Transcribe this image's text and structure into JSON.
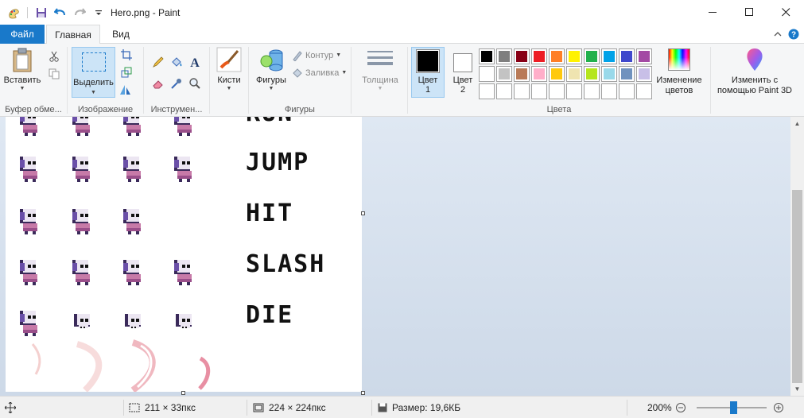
{
  "window": {
    "title": "Hero.png - Paint",
    "controls": {
      "minimize": "—",
      "maximize": "☐",
      "close": "✕"
    }
  },
  "quick_access": [
    {
      "icon": "paint-app-icon"
    },
    {
      "icon": "save-icon"
    },
    {
      "icon": "undo-icon"
    },
    {
      "icon": "redo-icon"
    },
    {
      "icon": "customize-qat-icon"
    }
  ],
  "tabs": {
    "file": "Файл",
    "home": "Главная",
    "view": "Вид"
  },
  "ribbon": {
    "clipboard": {
      "paste": "Вставить",
      "label": "Буфер обме..."
    },
    "image": {
      "select": "Выделить",
      "label": "Изображение"
    },
    "tools": {
      "label": "Инструмен..."
    },
    "brushes": {
      "label": "Кисти"
    },
    "shapes": {
      "shapes_button": "Фигуры",
      "outline": "Контур",
      "fill": "Заливка",
      "label": "Фигуры"
    },
    "thickness": {
      "label": "Толщина"
    },
    "colors": {
      "color1": "Цвет",
      "color1_num": "1",
      "color2": "Цвет",
      "color2_num": "2",
      "edit_colors_1": "Изменение",
      "edit_colors_2": "цветов",
      "label": "Цвета",
      "palette_row1": [
        "#000000",
        "#7f7f7f",
        "#880015",
        "#ed1c24",
        "#ff7f27",
        "#fff200",
        "#22b14c",
        "#00a2e8",
        "#3f48cc",
        "#a349a4"
      ],
      "palette_row2": [
        "#ffffff",
        "#c3c3c3",
        "#b97a57",
        "#ffaec9",
        "#ffc90e",
        "#efe4b0",
        "#b5e61d",
        "#99d9ea",
        "#7092be",
        "#c8bfe7"
      ],
      "color1_value": "#000000",
      "color2_value": "#ffffff"
    },
    "paint3d": {
      "line1": "Изменить с",
      "line2": "помощью Paint 3D"
    }
  },
  "canvas": {
    "labels": [
      "RUN",
      "JUMP",
      "HIT",
      "SLASH",
      "DIE"
    ]
  },
  "status": {
    "selection_size": "211 × 33пкс",
    "image_size": "224 × 224пкс",
    "file_size": "Размер: 19,6КБ",
    "zoom": "200%"
  }
}
